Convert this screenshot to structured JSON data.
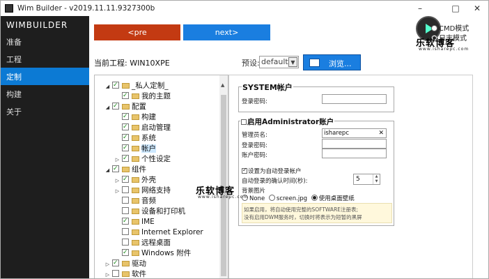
{
  "window": {
    "title": "Wim Builder - v2019.11.11.9327300b",
    "minimize": "–",
    "maximize": "□",
    "close": "✕"
  },
  "sidebar": {
    "brand": "WIMBUILDER",
    "items": [
      {
        "label": "准备",
        "active": false
      },
      {
        "label": "工程",
        "active": false
      },
      {
        "label": "定制",
        "active": true
      },
      {
        "label": "构建",
        "active": false
      },
      {
        "label": "关于",
        "active": false
      }
    ],
    "active_color": "#0c7ad4"
  },
  "nav": {
    "prev_label": "<pre",
    "next_label": "next>",
    "prev_color": "#c33a12",
    "next_color": "#1a7ee0"
  },
  "mode": {
    "cmd_label": "CMD模式",
    "log_label": "日志模式",
    "selected": "log"
  },
  "watermark": {
    "text": "乐软博客",
    "sub": "www.isharepc.com"
  },
  "project": {
    "label": "当前工程: WIN10XPE",
    "preset_label": "预设:",
    "preset_value": "default",
    "browse_label": "浏览..."
  },
  "tree": [
    {
      "label": "_私人定制_",
      "level": 0,
      "toggle": "◢",
      "checked": true
    },
    {
      "label": "我的主题",
      "level": 1,
      "toggle": "",
      "checked": true
    },
    {
      "label": "配置",
      "level": 0,
      "toggle": "◢",
      "checked": true
    },
    {
      "label": "构建",
      "level": 1,
      "toggle": "",
      "checked": true
    },
    {
      "label": "启动管理",
      "level": 1,
      "toggle": "",
      "checked": true
    },
    {
      "label": "系统",
      "level": 1,
      "toggle": "",
      "checked": true
    },
    {
      "label": "帐户",
      "level": 1,
      "toggle": "",
      "checked": true,
      "selected": true
    },
    {
      "label": "个性设定",
      "level": 1,
      "toggle": "▷",
      "checked": true
    },
    {
      "label": "组件",
      "level": 0,
      "toggle": "◢",
      "checked": true
    },
    {
      "label": "外壳",
      "level": 1,
      "toggle": "▷",
      "checked": true
    },
    {
      "label": "网络支持",
      "level": 1,
      "toggle": "▷",
      "checked": false
    },
    {
      "label": "音频",
      "level": 1,
      "toggle": "",
      "checked": false
    },
    {
      "label": "设备和打印机",
      "level": 1,
      "toggle": "",
      "checked": false
    },
    {
      "label": "IME",
      "level": 1,
      "toggle": "",
      "checked": true
    },
    {
      "label": "Internet Explorer",
      "level": 1,
      "toggle": "",
      "checked": false
    },
    {
      "label": "远程桌面",
      "level": 1,
      "toggle": "",
      "checked": false
    },
    {
      "label": "Windows 附件",
      "level": 1,
      "toggle": "",
      "checked": true
    },
    {
      "label": "驱动",
      "level": 0,
      "toggle": "▷",
      "checked": true
    },
    {
      "label": "软件",
      "level": 0,
      "toggle": "▷",
      "checked": false
    }
  ],
  "system_account": {
    "title": "SYSTEM帐户",
    "password_label": "登录密码:",
    "password_value": ""
  },
  "admin_account": {
    "title": "启用Administrator账户",
    "enabled": false,
    "admin_name_label": "管理员名:",
    "admin_name_value": "isharepc",
    "clear_icon": "✕",
    "login_password_label": "登录密码:",
    "account_password_label": "账户密码:",
    "autologin_label": "设置为自动登录帐户",
    "autologin_checked": true,
    "confirm_time_label": "自动登录的确认时间(秒):",
    "confirm_time_value": "5",
    "bg_label": "背景图片",
    "bg_options": [
      "None",
      "screen.jpg",
      "使用桌面壁纸"
    ],
    "bg_selected": 2,
    "notice_line1": "如果启用，将自动使用完整的SOFTWARE注册表;",
    "notice_line2": "没有启用DWM服务时，切换时将表示为短暂的黑屏"
  }
}
